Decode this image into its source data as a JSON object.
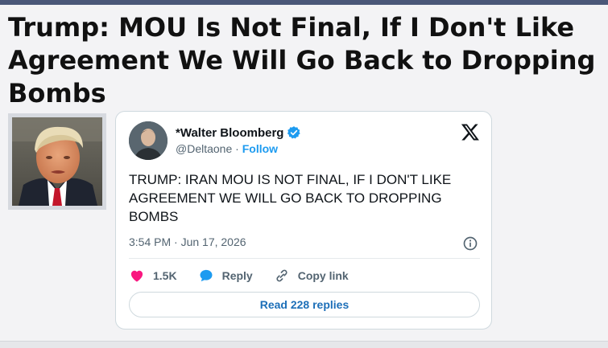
{
  "article": {
    "headline": "Trump: MOU Is Not Final, If I Don't Like Agreement We Will Go Back to Dropping Bombs"
  },
  "tweet": {
    "author_name": "*Walter Bloomberg",
    "handle": "@Deltaone",
    "separator": "·",
    "follow_label": "Follow",
    "text": "TRUMP: IRAN MOU IS NOT FINAL, IF I DON'T LIKE AGREEMENT WE WILL GO BACK TO DROPPING BOMBS",
    "timestamp": "3:54 PM · Jun 17, 2026",
    "like_count": "1.5K",
    "reply_label": "Reply",
    "copy_link_label": "Copy link",
    "read_replies_label": "Read 228 replies"
  },
  "colors": {
    "verified": "#1d9bf0",
    "like": "#f91880",
    "reply": "#1d9bf0",
    "topbar": "#4a5778"
  },
  "icons": {
    "verified": "verified-badge-icon",
    "brand": "x-logo-icon",
    "info": "info-icon",
    "like": "heart-icon",
    "reply": "speech-bubble-icon",
    "copy": "link-icon"
  }
}
